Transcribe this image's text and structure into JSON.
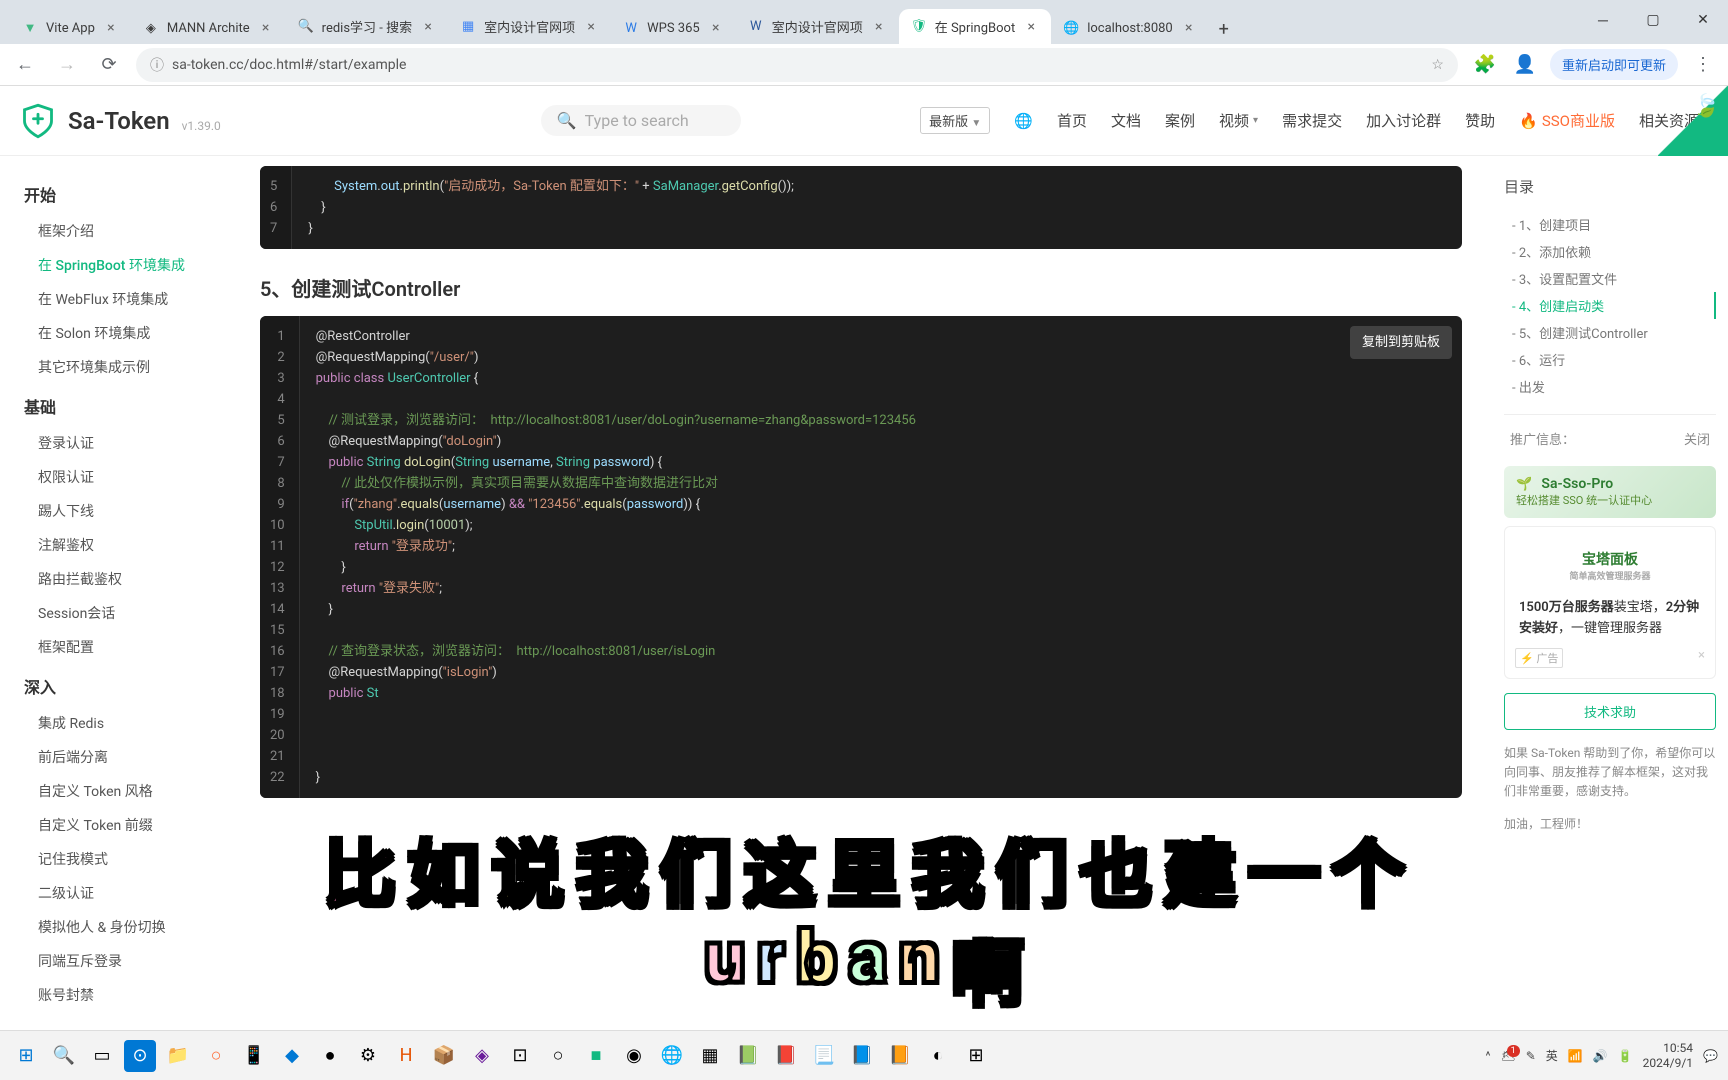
{
  "browser": {
    "tabs": [
      {
        "title": "Vite App",
        "icon_color": "#41b883"
      },
      {
        "title": "MANN Archite",
        "icon_color": "#555"
      },
      {
        "title": "redis学习 - 搜索",
        "icon_color": "#1976d2"
      },
      {
        "title": "室内设计官网项",
        "icon_color": "#4285f4"
      },
      {
        "title": "WPS 365",
        "icon_color": "#2c7be5"
      },
      {
        "title": "室内设计官网项",
        "icon_color": "#2b579a"
      },
      {
        "title": "在 SpringBoot",
        "icon_color": "#12b981",
        "active": true
      },
      {
        "title": "localhost:8080",
        "icon_color": "#666"
      }
    ],
    "address": "sa-token.cc/doc.html#/start/example",
    "update_text": "重新启动即可更新"
  },
  "header": {
    "logo_text": "Sa-Token",
    "version": "v1.39.0",
    "search_placeholder": "Type to search",
    "version_select": "最新版",
    "nav": [
      "首页",
      "文档",
      "案例",
      "视频",
      "需求提交",
      "加入讨论群",
      "赞助",
      "SSO商业版",
      "相关资源"
    ]
  },
  "sidebar": {
    "g1_title": "开始",
    "g1": [
      "框架介绍",
      "在 SpringBoot 环境集成",
      "在 WebFlux 环境集成",
      "在 Solon 环境集成",
      "其它环境集成示例"
    ],
    "g2_title": "基础",
    "g2": [
      "登录认证",
      "权限认证",
      "踢人下线",
      "注解鉴权",
      "路由拦截鉴权",
      "Session会话",
      "框架配置"
    ],
    "g3_title": "深入",
    "g3": [
      "集成 Redis",
      "前后端分离",
      "自定义 Token 风格",
      "自定义 Token 前缀",
      "记住我模式",
      "二级认证",
      "模拟他人 & 身份切换",
      "同端互斥登录",
      "账号封禁"
    ]
  },
  "content": {
    "code1_lines": [
      "5",
      "6",
      "7"
    ],
    "section_title": "5、创建测试Controller",
    "copy_btn": "复制到剪贴板",
    "code2_lines": [
      "1",
      "2",
      "3",
      "4",
      "5",
      "6",
      "7",
      "8",
      "9",
      "10",
      "11",
      "12",
      "13",
      "14",
      "15",
      "16",
      "17",
      "18",
      "19",
      "20",
      "21",
      "22"
    ]
  },
  "toc": {
    "title": "目录",
    "items": [
      "- 1、创建项目",
      "- 2、添加依赖",
      "- 3、设置配置文件",
      "- 4、创建启动类",
      "- 5、创建测试Controller",
      "- 6、运行",
      "- 出发"
    ],
    "active_index": 3,
    "promo_header": "推广信息：",
    "promo_close": "关闭",
    "sso_title": "Sa-Sso-Pro",
    "sso_sub": "轻松搭建 SSO 统一认证中心",
    "bt_title": "宝塔面板",
    "bt_sub": "简单高效管理服务器",
    "bt_desc1": "1500万台服务器",
    "bt_desc1b": "装宝塔，",
    "bt_desc2": "2分钟安装好",
    "bt_desc2b": "，一键管理服务器",
    "ad_label": "⚡ 广告",
    "help_btn": "技术求助",
    "help_text": "如果 Sa-Token 帮助到了你，希望你可以向同事、朋友推荐了解本框架，这对我们非常重要，感谢支持。",
    "cheer": "加油，工程师！"
  },
  "taskbar": {
    "time": "10:54",
    "date": "2024/9/1",
    "notif_count": "1"
  },
  "overlay": {
    "line1": [
      "比",
      "如",
      "说",
      "我",
      "们",
      "这",
      "里",
      "我",
      "们",
      "也",
      "建",
      "一",
      "个"
    ],
    "line2": [
      "u",
      "r",
      "b",
      "a",
      "n",
      "啊"
    ],
    "colors": [
      "#ff7eb9",
      "#7eaaff",
      "#fff07e",
      "#c6ffb8",
      "#ffc87e",
      "#b8d8ff",
      "#ffb8f0",
      "#a0e0ff",
      "#ffe8a0",
      "#c0ffd8",
      "#d0baff",
      "#a8ffc8",
      "#ffb8a8"
    ]
  }
}
